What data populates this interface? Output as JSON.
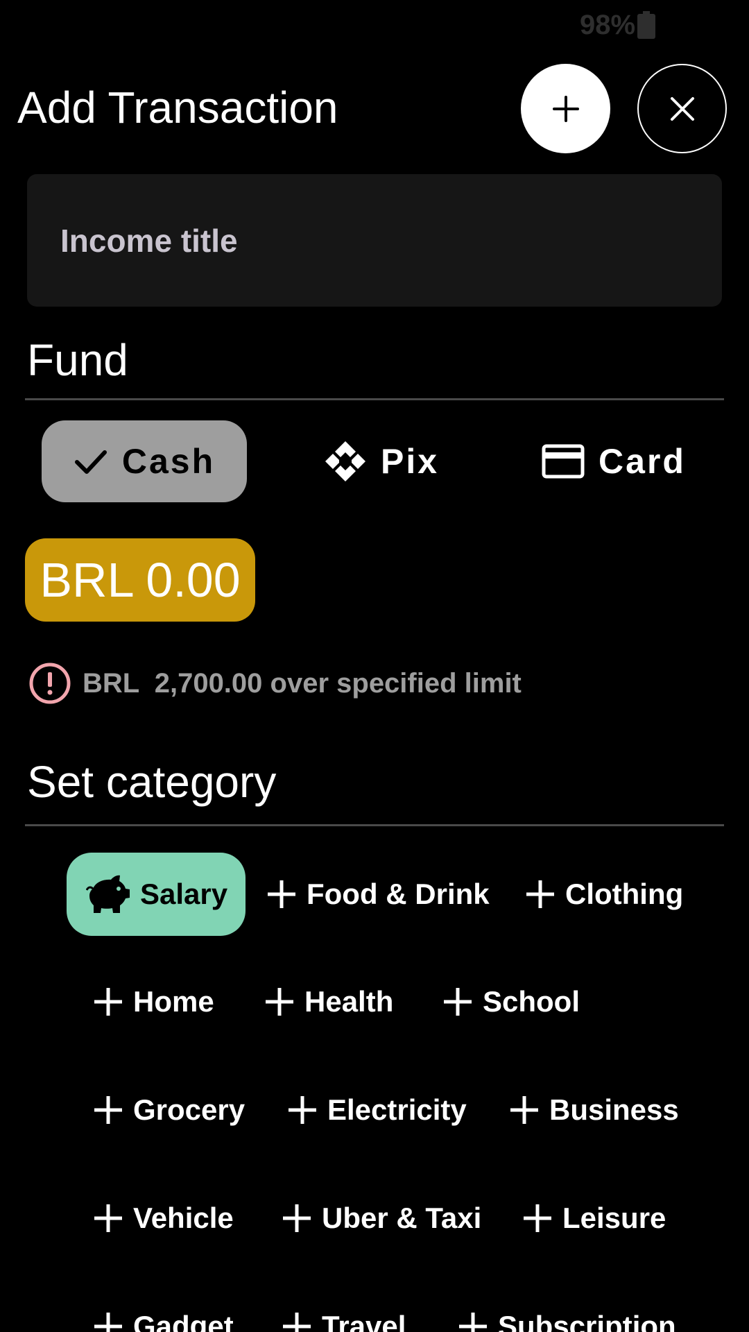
{
  "status_bar": {
    "battery": "98%",
    "battery_icon": "battery-icon"
  },
  "header": {
    "title": "Add Transaction",
    "add_icon": "plus-icon",
    "close_icon": "close-icon"
  },
  "title_input": {
    "placeholder": "Income title",
    "value": ""
  },
  "fund": {
    "section_title": "Fund",
    "options": [
      {
        "label": "Cash",
        "icon": "check-icon",
        "selected": true
      },
      {
        "label": "Pix",
        "icon": "pix-icon",
        "selected": false
      },
      {
        "label": "Card",
        "icon": "credit-card-icon",
        "selected": false
      }
    ]
  },
  "amount": {
    "value": "BRL 0.00",
    "color": "#c9980a"
  },
  "warning": {
    "icon": "alert-circle-icon",
    "text": "BRL  2,700.00 over specified limit",
    "icon_color": "#f2a5ad"
  },
  "category": {
    "section_title": "Set category",
    "selected_color": "#81d4b4",
    "items": [
      {
        "label": "Salary",
        "icon": "piggy-bank-icon",
        "selected": true
      },
      {
        "label": "Food & Drink",
        "icon": "plus-icon",
        "selected": false
      },
      {
        "label": "Clothing",
        "icon": "plus-icon",
        "selected": false
      },
      {
        "label": "Home",
        "icon": "plus-icon",
        "selected": false
      },
      {
        "label": "Health",
        "icon": "plus-icon",
        "selected": false
      },
      {
        "label": "School",
        "icon": "plus-icon",
        "selected": false
      },
      {
        "label": "Grocery",
        "icon": "plus-icon",
        "selected": false
      },
      {
        "label": "Electricity",
        "icon": "plus-icon",
        "selected": false
      },
      {
        "label": "Business",
        "icon": "plus-icon",
        "selected": false
      },
      {
        "label": "Vehicle",
        "icon": "plus-icon",
        "selected": false
      },
      {
        "label": "Uber & Taxi",
        "icon": "plus-icon",
        "selected": false
      },
      {
        "label": "Leisure",
        "icon": "plus-icon",
        "selected": false
      },
      {
        "label": "Gadget",
        "icon": "plus-icon",
        "selected": false
      },
      {
        "label": "Travel",
        "icon": "plus-icon",
        "selected": false
      },
      {
        "label": "Subscription",
        "icon": "plus-icon",
        "selected": false
      }
    ]
  }
}
